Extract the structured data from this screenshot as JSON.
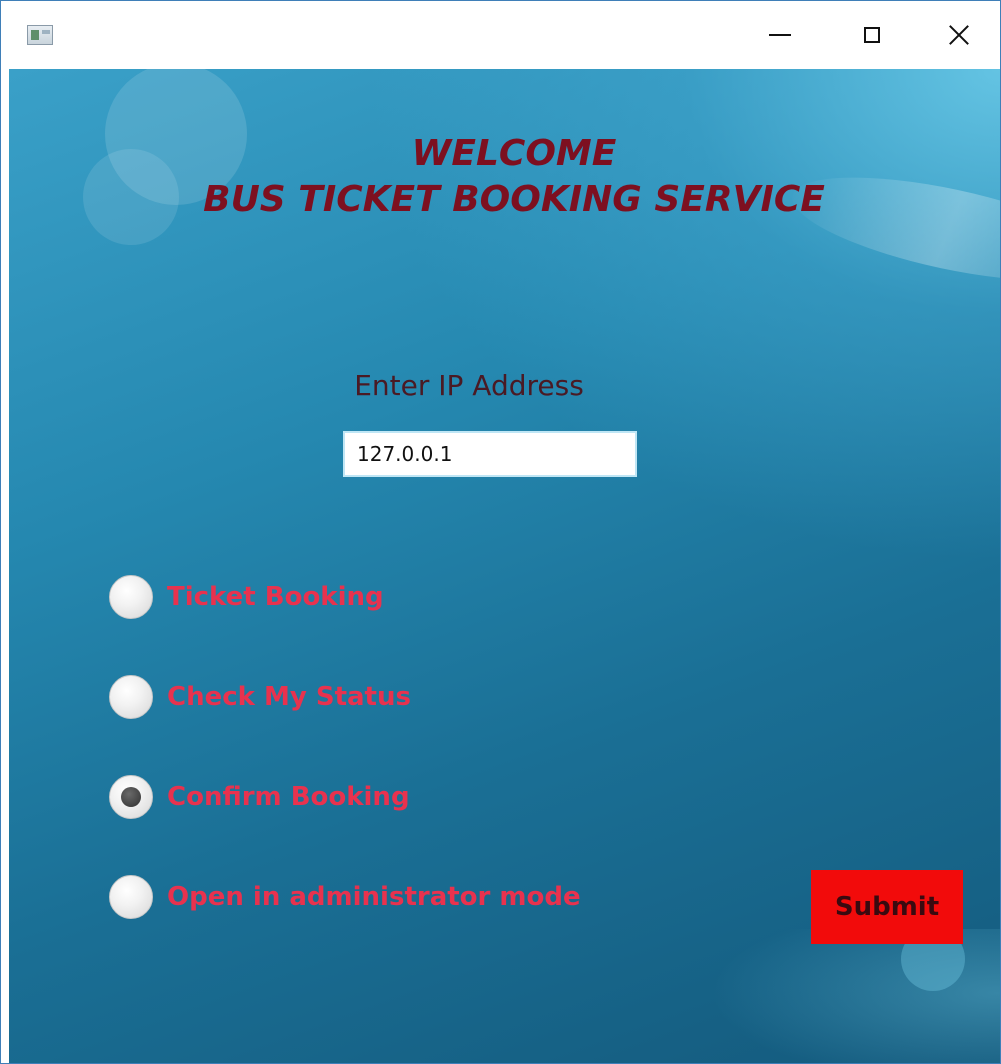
{
  "window": {
    "minimize_icon": "minimize-icon",
    "maximize_icon": "maximize-icon",
    "close_icon": "close-icon"
  },
  "heading": {
    "line1": "WELCOME",
    "line2": "BUS TICKET BOOKING SERVICE"
  },
  "ip": {
    "label": "Enter IP Address",
    "value": "127.0.0.1"
  },
  "options": [
    {
      "label": "Ticket Booking",
      "selected": false
    },
    {
      "label": "Check My Status",
      "selected": false
    },
    {
      "label": "Confirm Booking",
      "selected": true
    },
    {
      "label": "Open in administrator mode",
      "selected": false
    }
  ],
  "submit": {
    "label": "Submit"
  },
  "colors": {
    "heading": "#7d1020",
    "option_text": "#e8324e",
    "submit_bg": "#f20b0b",
    "background_accent": "#2588b0"
  }
}
